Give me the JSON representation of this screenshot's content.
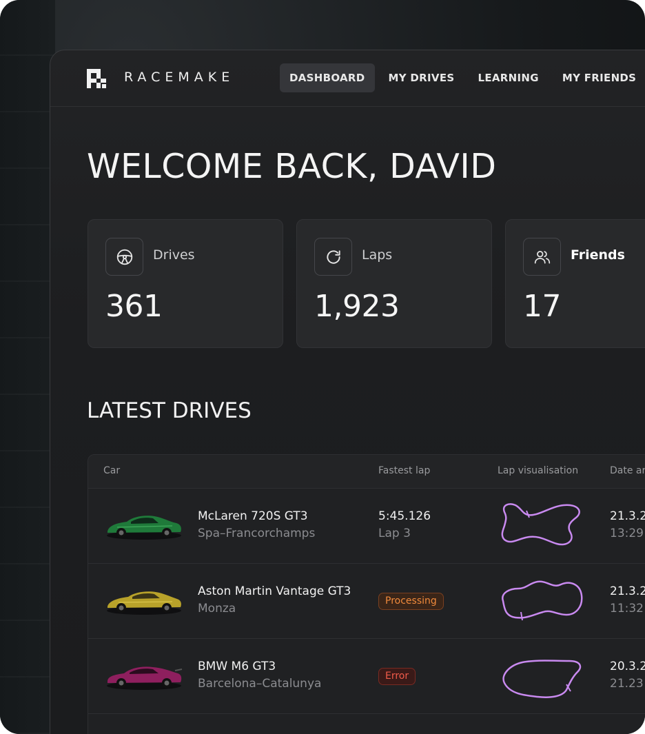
{
  "app": {
    "brand": "RACEMAKE"
  },
  "nav": {
    "items": [
      {
        "label": "DASHBOARD",
        "active": true
      },
      {
        "label": "MY DRIVES",
        "active": false
      },
      {
        "label": "LEARNING",
        "active": false
      },
      {
        "label": "MY FRIENDS",
        "active": false
      }
    ]
  },
  "welcome": "WELCOME BACK, DAVID",
  "stats": [
    {
      "label": "Drives",
      "value": "361",
      "icon": "steering-wheel-icon"
    },
    {
      "label": "Laps",
      "value": "1,923",
      "icon": "refresh-icon"
    },
    {
      "label": "Friends",
      "value": "17",
      "icon": "users-icon"
    }
  ],
  "latest_drives": {
    "title": "LATEST DRIVES",
    "columns": [
      "Car",
      "Fastest lap",
      "Lap visualisation",
      "Date ar"
    ],
    "rows": [
      {
        "car": "McLaren 720S GT3",
        "track": "Spa–Francorchamps",
        "fastest_lap": "5:45.126",
        "lap": "Lap 3",
        "status": null,
        "date": "21.3.2",
        "time": "13:29",
        "car_color": "#1f7a3a"
      },
      {
        "car": "Aston Martin Vantage GT3",
        "track": "Monza",
        "fastest_lap": null,
        "lap": null,
        "status": "Processing",
        "date": "21.3.2",
        "time": "11:32",
        "car_color": "#b8a22a"
      },
      {
        "car": "BMW M6 GT3",
        "track": "Barcelona–Catalunya",
        "fastest_lap": null,
        "lap": null,
        "status": "Error",
        "date": "20.3.2",
        "time": "21.23",
        "car_color": "#8e1f5e"
      }
    ]
  },
  "colors": {
    "lap_line": "#c98af0",
    "processing": "#f08a3c",
    "error": "#f05b4a"
  }
}
